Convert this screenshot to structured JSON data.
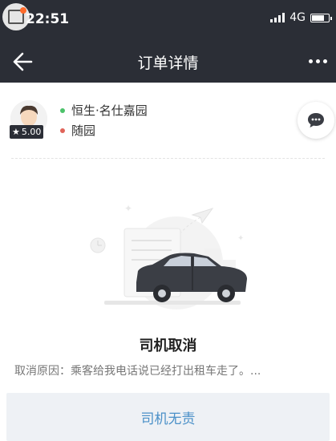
{
  "status_bar": {
    "time": "22:51",
    "network": "4G"
  },
  "nav": {
    "title": "订单详情"
  },
  "driver": {
    "rating": "5.00"
  },
  "route": {
    "start": "恒生·名仕嘉园",
    "end": "随园",
    "start_color": "#4cc26a",
    "end_color": "#e0645a"
  },
  "cancel": {
    "title": "司机取消",
    "reason": "取消原因：乘客给我电话说已经打出租车走了。..."
  },
  "bottom_button": {
    "label": "司机无责"
  },
  "colors": {
    "header_bg": "#2b2e36",
    "link_blue": "#4a90c8"
  }
}
